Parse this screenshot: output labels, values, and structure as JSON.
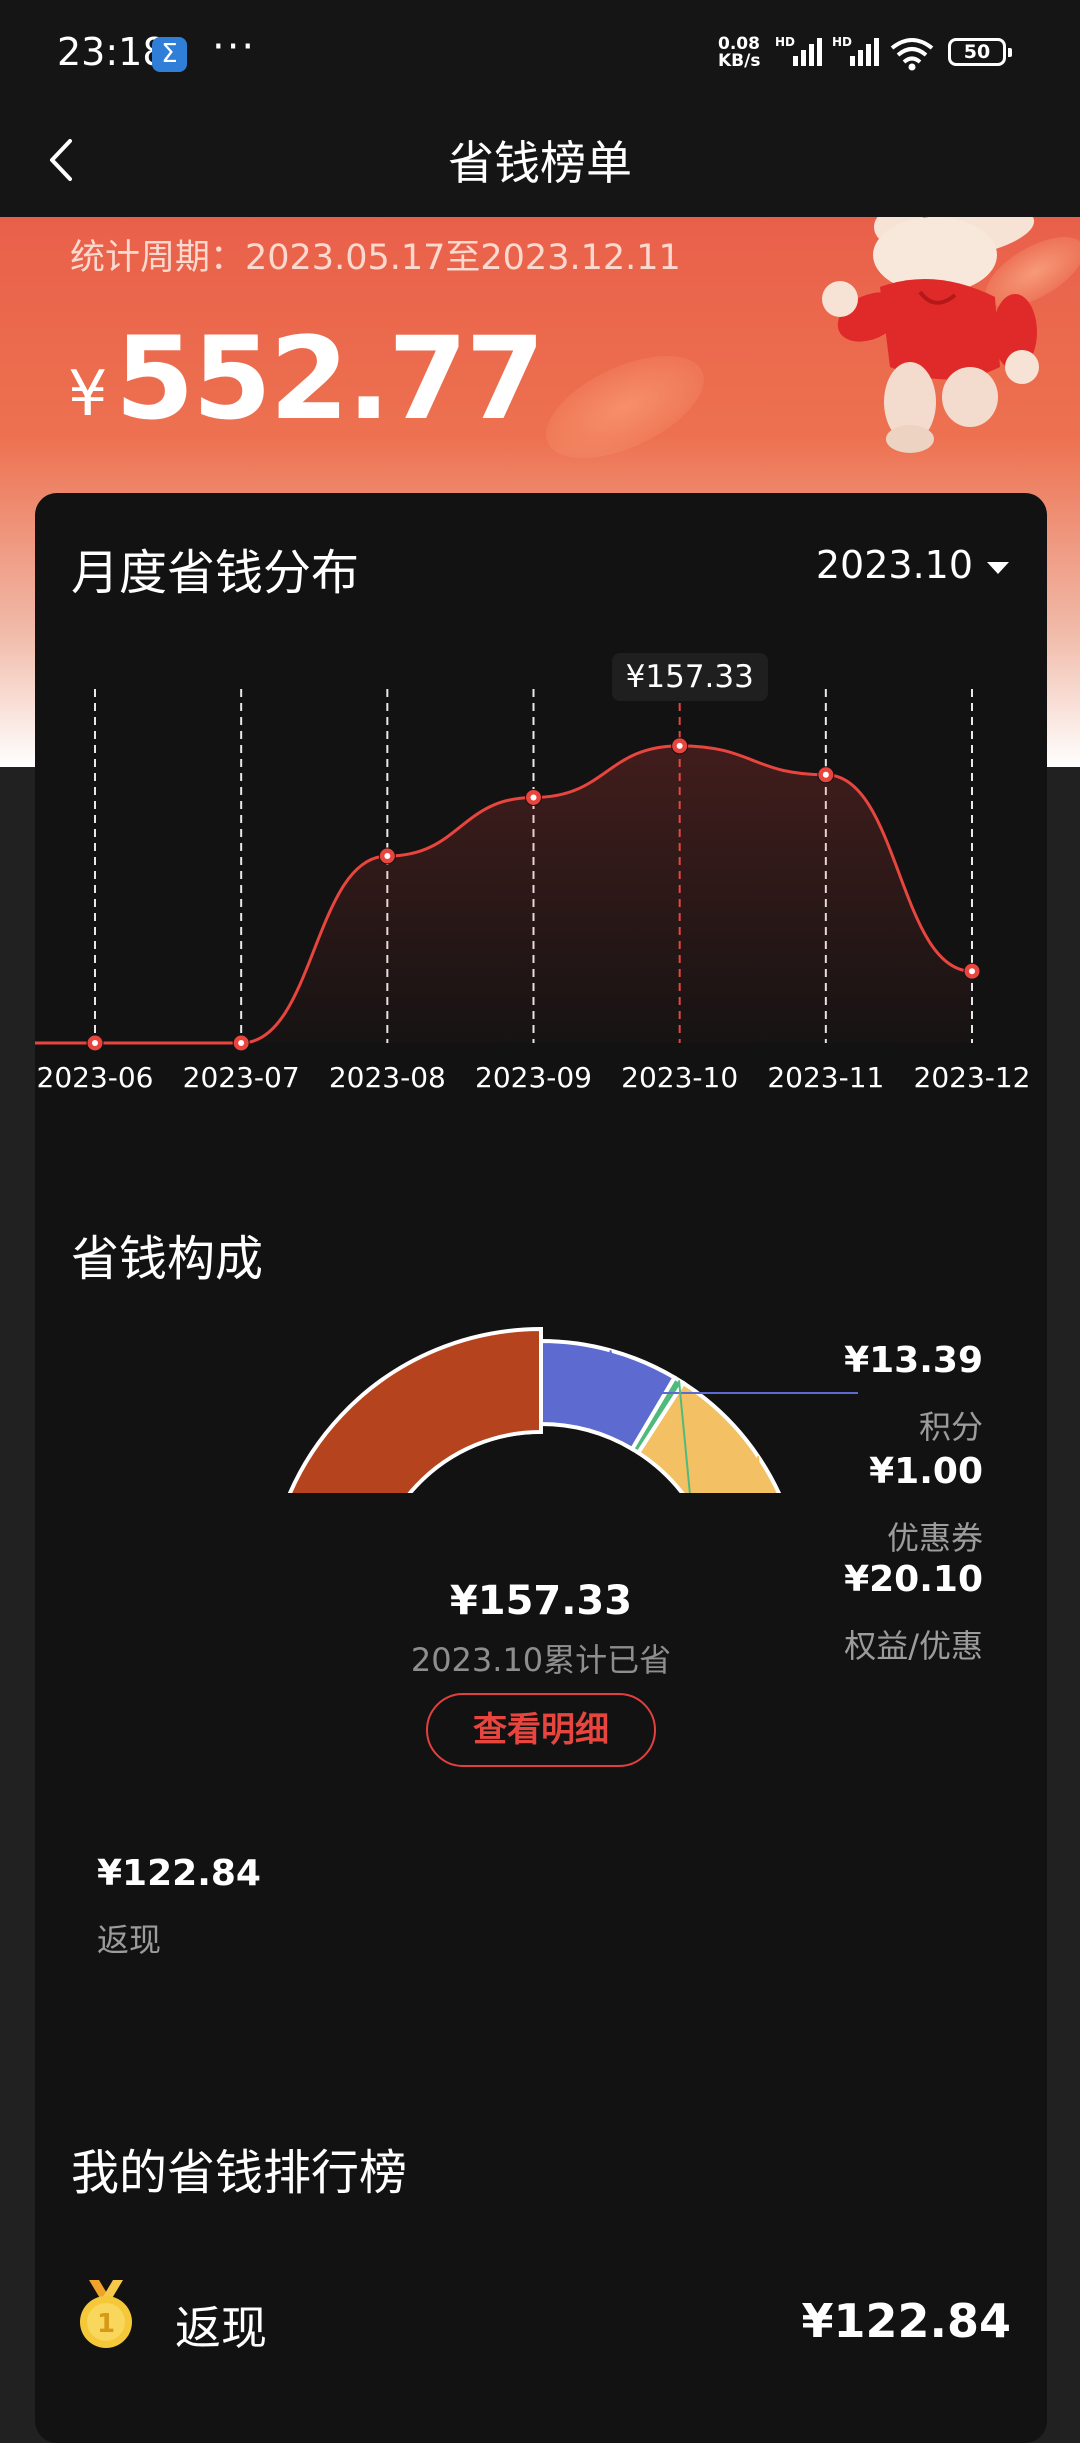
{
  "status_bar": {
    "time": "23:18",
    "app_badge": "Σ",
    "overflow": "···",
    "net_speed_value": "0.08",
    "net_speed_unit": "KB/s",
    "signal_label_1": "HD",
    "signal_label_2": "HD",
    "battery": "50",
    "icons": [
      "sigma-app-icon",
      "signal-icon",
      "wifi-icon",
      "battery-icon"
    ]
  },
  "header": {
    "title": "省钱榜单",
    "back_icon": "chevron-left-icon"
  },
  "summary": {
    "period": "统计周期：2023.05.17至2023.12.11",
    "currency": "¥",
    "total_saved": "552.77"
  },
  "monthly": {
    "title": "月度省钱分布",
    "selected_month": "2023.10",
    "tooltip": "¥157.33",
    "accent_color": "#e8453f"
  },
  "chart_data": {
    "type": "line",
    "title": "月度省钱分布",
    "categories": [
      "2023-06",
      "2023-07",
      "2023-08",
      "2023-09",
      "2023-10",
      "2023-11",
      "2023-12"
    ],
    "values": [
      0,
      0,
      99,
      130,
      157.33,
      142,
      38
    ],
    "highlighted_category": "2023-10",
    "highlighted_value": 157.33,
    "grid": "vertical-dashed",
    "ylim": [
      0,
      180
    ]
  },
  "composition": {
    "title": "省钱构成",
    "center_amount": "¥157.33",
    "center_subtitle": "2023.10累计已省",
    "detail_button": "查看明细",
    "segments": [
      {
        "name": "积分",
        "amount": "¥13.39",
        "value": 13.39,
        "color": "#5d6bd1"
      },
      {
        "name": "优惠券",
        "amount": "¥1.00",
        "value": 1.0,
        "color": "#4fba7c"
      },
      {
        "name": "权益/优惠",
        "amount": "¥20.10",
        "value": 20.1,
        "color": "#f3c063"
      },
      {
        "name": "返现",
        "amount": "¥122.84",
        "value": 122.84,
        "color": "#b5431e"
      }
    ]
  },
  "ranking": {
    "title": "我的省钱排行榜",
    "rows": [
      {
        "rank": "1",
        "name": "返现",
        "amount": "¥122.84",
        "medal_color": "#f5c83a"
      }
    ]
  }
}
